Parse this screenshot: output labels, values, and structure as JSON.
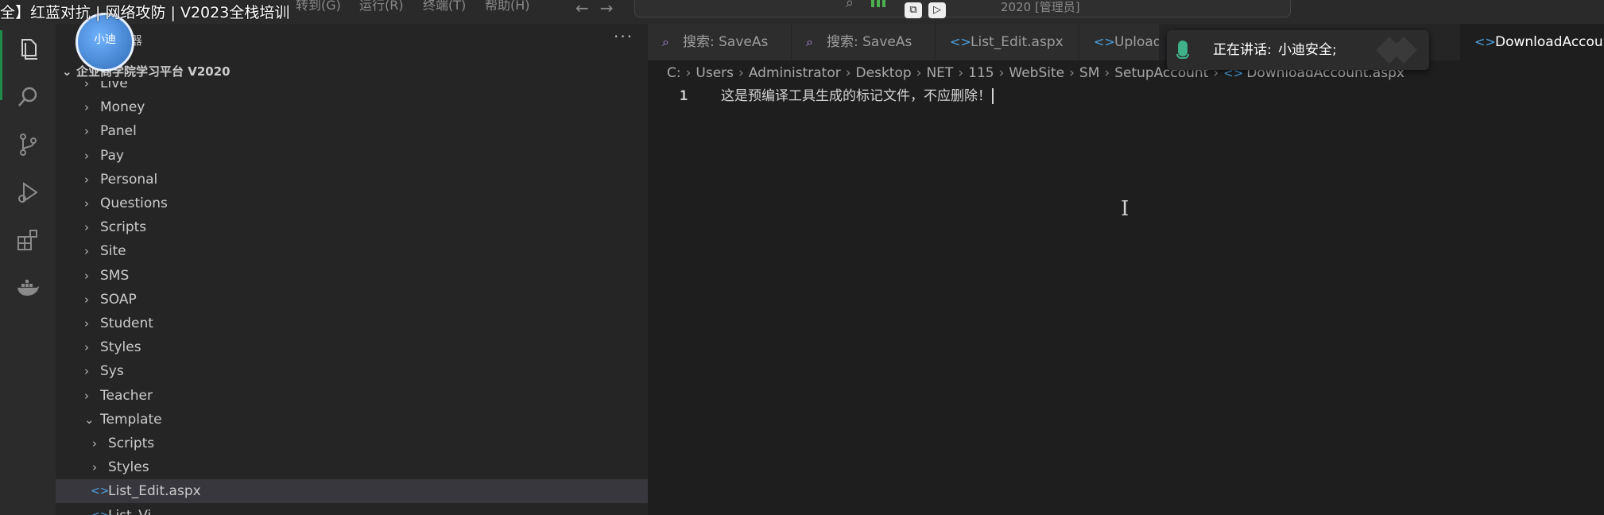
{
  "video_title": "全】红蓝对抗 | 网络攻防 | V2023全栈培训",
  "menu": {
    "goto": "转到(G)",
    "run": "运行(R)",
    "terminal": "终端(T)",
    "help": "帮助(H)"
  },
  "command_center": {
    "text": "2020 [管理员]"
  },
  "player_icons": [
    "minimize-to-pip-icon",
    "play-in-window-icon"
  ],
  "activity_bar": {
    "icons": [
      "explorer-icon",
      "search-icon",
      "source-control-icon",
      "run-debug-icon",
      "extensions-icon",
      "docker-icon"
    ]
  },
  "sidebar": {
    "title": "资源管理器",
    "more": "···",
    "project": "企业商学院学习平台 V2020",
    "tree": [
      {
        "label": "Live",
        "type": "folder",
        "expanded": false,
        "depth": 1
      },
      {
        "label": "Money",
        "type": "folder",
        "expanded": false,
        "depth": 1
      },
      {
        "label": "Panel",
        "type": "folder",
        "expanded": false,
        "depth": 1
      },
      {
        "label": "Pay",
        "type": "folder",
        "expanded": false,
        "depth": 1
      },
      {
        "label": "Personal",
        "type": "folder",
        "expanded": false,
        "depth": 1
      },
      {
        "label": "Questions",
        "type": "folder",
        "expanded": false,
        "depth": 1
      },
      {
        "label": "Scripts",
        "type": "folder",
        "expanded": false,
        "depth": 1
      },
      {
        "label": "Site",
        "type": "folder",
        "expanded": false,
        "depth": 1
      },
      {
        "label": "SMS",
        "type": "folder",
        "expanded": false,
        "depth": 1
      },
      {
        "label": "SOAP",
        "type": "folder",
        "expanded": false,
        "depth": 1
      },
      {
        "label": "Student",
        "type": "folder",
        "expanded": false,
        "depth": 1
      },
      {
        "label": "Styles",
        "type": "folder",
        "expanded": false,
        "depth": 1
      },
      {
        "label": "Sys",
        "type": "folder",
        "expanded": false,
        "depth": 1
      },
      {
        "label": "Teacher",
        "type": "folder",
        "expanded": false,
        "depth": 1
      },
      {
        "label": "Template",
        "type": "folder",
        "expanded": true,
        "depth": 1
      },
      {
        "label": "Scripts",
        "type": "folder",
        "expanded": false,
        "depth": 2
      },
      {
        "label": "Styles",
        "type": "folder",
        "expanded": false,
        "depth": 2
      },
      {
        "label": "List_Edit.aspx",
        "type": "file",
        "selected": true,
        "depth": 2
      },
      {
        "label": "List_Vi...",
        "type": "file",
        "depth": 2
      }
    ]
  },
  "tabs": [
    {
      "label": "搜索: SaveAs",
      "icon": "search-icon",
      "active": false
    },
    {
      "label": "搜索: SaveAs",
      "icon": "search-icon",
      "active": false
    },
    {
      "label": "List_Edit.aspx",
      "icon": "code-file-icon",
      "active": false
    },
    {
      "label": "Upload",
      "icon": "code-file-icon",
      "active": false
    },
    {
      "label": "DownloadAccount.a",
      "icon": "code-file-icon",
      "active": true
    }
  ],
  "breadcrumb": [
    "C:",
    "Users",
    "Administrator",
    "Desktop",
    "NET",
    "115",
    "WebSite",
    "SM",
    "SetupAccount",
    "DownloadAccount.aspx"
  ],
  "editor": {
    "line_number": "1",
    "line_text": "这是预编译工具生成的标记文件，不应删除！"
  },
  "voice_popup": {
    "status": "正在讲话:",
    "speaker": "小迪安全;"
  },
  "colors": {
    "accent_green": "#1e8a4b",
    "mic_green": "#3fb28a",
    "file_icon_blue": "#4fa3e0",
    "search_icon_purple": "#b48ede"
  }
}
